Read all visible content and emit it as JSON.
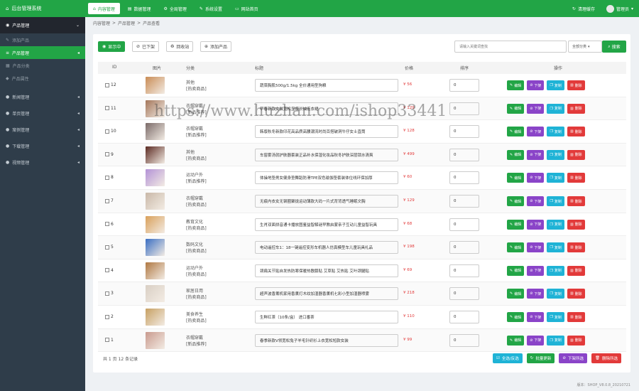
{
  "app": {
    "brand": "后台管理系统"
  },
  "topnav": [
    {
      "label": "内容管理",
      "icon": "home-icon",
      "active": true
    },
    {
      "label": "数据管理",
      "icon": "chart-icon"
    },
    {
      "label": "全局管理",
      "icon": "gear-icon"
    },
    {
      "label": "系统设置",
      "icon": "wrench-icon"
    },
    {
      "label": "网站首页",
      "icon": "monitor-icon"
    }
  ],
  "topright": {
    "clear_cache": "清理缓存",
    "user": "管理员"
  },
  "sidebar": {
    "groups": [
      {
        "label": "产品管理",
        "open": true
      },
      {
        "label": "新闻管理"
      },
      {
        "label": "单页管理"
      },
      {
        "label": "案例管理"
      },
      {
        "label": "下载管理"
      },
      {
        "label": "视频管理"
      }
    ],
    "items": [
      "添加产品",
      "产品管理",
      "产品分类",
      "产品属性"
    ]
  },
  "breadcrumb": [
    "内容管理",
    "产品管理",
    "产品查看"
  ],
  "toolbar": {
    "show_all": "显示中",
    "off_shelf": "已下架",
    "recycle": "回收站",
    "add": "添加产品",
    "search_placeholder": "请输入关键词查找",
    "category": "全部分类",
    "search": "搜索"
  },
  "table": {
    "headers": {
      "id": "ID",
      "image": "图片",
      "category": "分类",
      "title": "标题",
      "price": "价格",
      "sort": "排序",
      "actions": "操作"
    },
    "actions": {
      "edit": "编辑",
      "down": "下架",
      "copy": "复制",
      "delete": "删除"
    },
    "rows": [
      {
        "id": "12",
        "cat": "其他",
        "tag": "[热卖商品]",
        "title": "蔬菜胸肌500g/1.5kg 全价通用型狗粮",
        "price": "¥ 56",
        "sort": "0",
        "thumb": "#c98c55"
      },
      {
        "id": "11",
        "cat": "衣帽穿戴",
        "tag": "[新品推荐]",
        "title": "早春新款女装宽松显瘦长袖连衣裙",
        "price": "¥ 129",
        "sort": "0",
        "thumb": "#a4765a"
      },
      {
        "id": "10",
        "cat": "衣帽穿戴",
        "tag": "[新品推荐]",
        "title": "韩版秋冬新款印花高品质高腰潮流时尚百搭破洞牛仔女士直筒",
        "price": "¥ 128",
        "sort": "0",
        "thumb": "#7a6a68"
      },
      {
        "id": "9",
        "cat": "其他",
        "tag": "[热卖商品]",
        "title": "车窗雾汤就护肤器套装正品补水保湿化妆品秋冬护肤深层锁水清爽",
        "price": "¥ 499",
        "sort": "0",
        "thumb": "#5b2a22"
      },
      {
        "id": "8",
        "cat": "运动户外",
        "tag": "[新品推荐]",
        "title": "体操地垫男女健身垫舞蹈防滑TPE双色瑜伽垫套装体位线环保加厚",
        "price": "¥ 60",
        "sort": "0",
        "thumb": "#b392d6"
      },
      {
        "id": "7",
        "cat": "衣帽穿戴",
        "tag": "[热卖商品]",
        "title": "无痕内衣女无钢圈聚拢运动薄款大码一片式背背透气睡眠文胸",
        "price": "¥ 129",
        "sort": "0",
        "thumb": "#c9b8a8"
      },
      {
        "id": "6",
        "cat": "教育文化",
        "tag": "[热卖商品]",
        "title": "生肖双面拼音通卡播放图鉴益智解谜早教启蒙亲子互动儿童益智玩具",
        "price": "¥ 68",
        "sort": "0",
        "thumb": "#d9a05a"
      },
      {
        "id": "5",
        "cat": "数码文化",
        "tag": "[热卖商品]",
        "title": "电动遥控车1：18一键遥控变形车机器人仿真模型车儿童玩具礼品",
        "price": "¥ 198",
        "sort": "0",
        "thumb": "#3a6ec2"
      },
      {
        "id": "4",
        "cat": "运动户外",
        "tag": "[热卖商品]",
        "title": "颈扁关节贴自发热防寒保暖热敷膝贴 艾草贴 艾热贴 艾叶颈腿贴",
        "price": "¥ 69",
        "sort": "0",
        "thumb": "#b07842"
      },
      {
        "id": "3",
        "cat": "家居日用",
        "tag": "[热卖商品]",
        "title": "超声波香薰机家用香薰灯木纹加湿器香薰机七彩小型加湿器喷雾",
        "price": "¥ 218",
        "sort": "0",
        "thumb": "#d9cfc4"
      },
      {
        "id": "2",
        "cat": "美食养生",
        "tag": "[热卖商品]",
        "title": "生鲜红茶（10条/盒） 进口番茶",
        "price": "¥ 110",
        "sort": "0",
        "thumb": "#c7a062"
      },
      {
        "id": "1",
        "cat": "衣帽穿戴",
        "tag": "[新品推荐]",
        "title": "春季新款V领宽松兔子羊毛针织衫上衣宽松短款女装",
        "price": "¥ 99",
        "sort": "0",
        "thumb": "#c99a8e"
      }
    ]
  },
  "footer": {
    "count": "共 1 页 12 条记录",
    "select_all": "全选/反选",
    "bulk_update": "批量更新",
    "bulk_down": "下架所选",
    "bulk_delete": "删除所选",
    "version": "版本：SHOP_V8.0.8_20210721"
  },
  "watermark": "https://www.huzhan.com/ishop33441"
}
